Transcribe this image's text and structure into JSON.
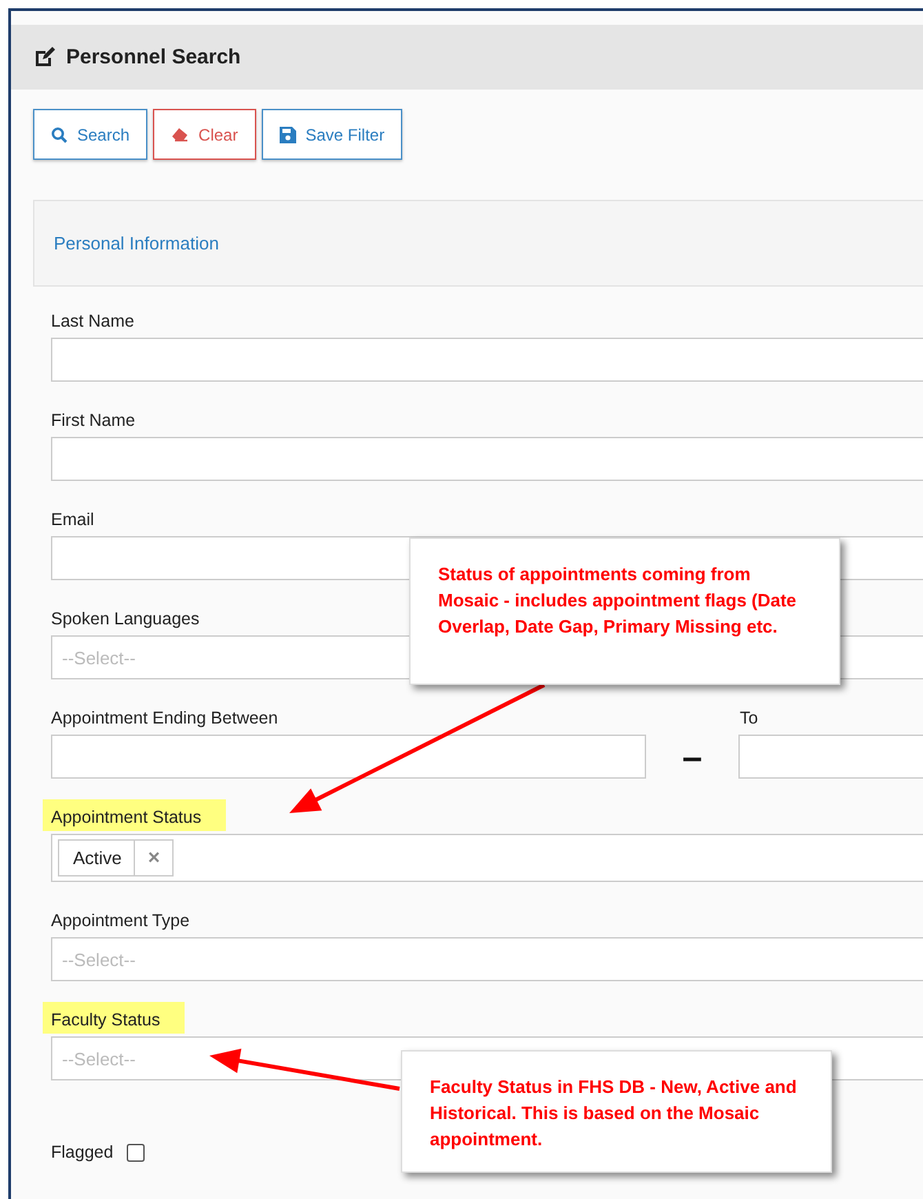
{
  "header": {
    "title": "Personnel Search"
  },
  "buttons": [
    {
      "label": "Search",
      "kind": "search"
    },
    {
      "label": "Clear",
      "kind": "clear"
    },
    {
      "label": "Save Filter",
      "kind": "save"
    }
  ],
  "section": {
    "title": "Personal Information"
  },
  "fields": [
    {
      "kind": "text",
      "label": "Last Name",
      "highlighted": false
    },
    {
      "kind": "text",
      "label": "First Name",
      "highlighted": false
    },
    {
      "kind": "text",
      "label": "Email",
      "highlighted": false
    },
    {
      "kind": "select",
      "label": "Spoken Languages",
      "placeholder": "--Select--",
      "highlighted": false
    },
    {
      "kind": "range",
      "label": "Appointment Ending Between",
      "to_label": "To",
      "separator": "–",
      "highlighted": false
    },
    {
      "kind": "tags",
      "label": "Appointment Status",
      "highlighted": true,
      "tags": [
        {
          "label": "Active",
          "remove": "×"
        }
      ]
    },
    {
      "kind": "select",
      "label": "Appointment Type",
      "placeholder": "--Select--",
      "highlighted": false
    },
    {
      "kind": "select",
      "label": "Faculty Status",
      "placeholder": "--Select--",
      "highlighted": true
    },
    {
      "kind": "checkbox",
      "label": "Flagged",
      "checked": false
    }
  ],
  "annotations": [
    {
      "text": "Status of appointments coming from Mosaic - includes appointment flags (Date Overlap, Date Gap, Primary Missing etc."
    },
    {
      "text": "Faculty Status in FHS DB - New, Active and Historical. This is based on the Mosaic appointment."
    }
  ]
}
